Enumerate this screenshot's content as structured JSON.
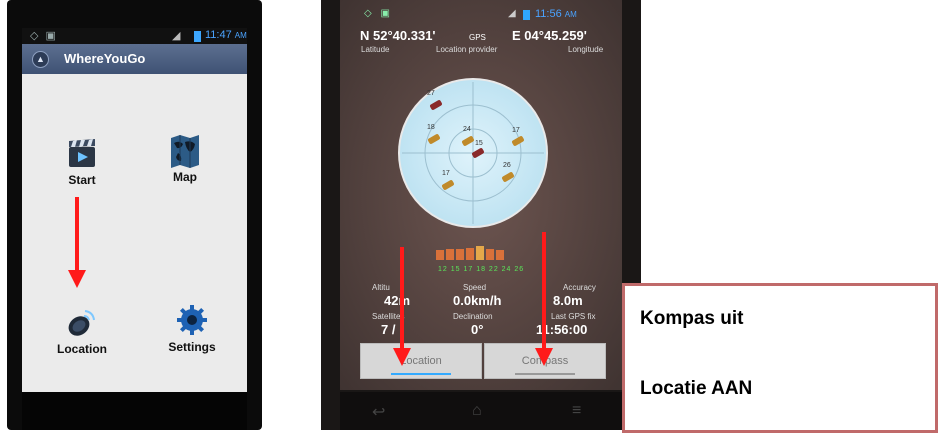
{
  "phone1": {
    "status": {
      "time": "11:47",
      "ampm": "AM"
    },
    "app_title": "WhereYouGo",
    "menu": [
      {
        "label": "Start",
        "icon": "clapperboard-icon"
      },
      {
        "label": "Map",
        "icon": "world-map-icon"
      },
      {
        "label": "Location",
        "icon": "satellite-dish-icon"
      },
      {
        "label": "Settings",
        "icon": "gear-icon"
      }
    ]
  },
  "phone2": {
    "status": {
      "time": "11:56",
      "ampm": "AM"
    },
    "latitude_value": "N 52°40.331'",
    "provider_value": "GPS",
    "longitude_value": "E 04°45.259'",
    "latitude_label": "Latitude",
    "provider_label": "Location provider",
    "longitude_label": "Longitude",
    "satellites": [
      "27",
      "18",
      "24",
      "15",
      "17",
      "26",
      "17"
    ],
    "snr_labels": "12 15 17 18 22 24 26",
    "stats": [
      {
        "label": "Altitu",
        "value": "42m"
      },
      {
        "label": "Speed",
        "value": "0.0km/h"
      },
      {
        "label": "Accuracy",
        "value": "8.0m"
      },
      {
        "label": "Satellites",
        "value": "7 /"
      },
      {
        "label": "Declination",
        "value": "0°"
      },
      {
        "label": "Last GPS fix",
        "value": "11:56:00"
      }
    ],
    "tabs": {
      "location": "Location",
      "compass": "Compass"
    }
  },
  "callout": {
    "line1": "Kompas uit",
    "line2": "Locatie AAN"
  },
  "colors": {
    "arrow": "#ff1a1a",
    "accent": "#4aa3ff",
    "callout_border": "#c06a6a"
  }
}
